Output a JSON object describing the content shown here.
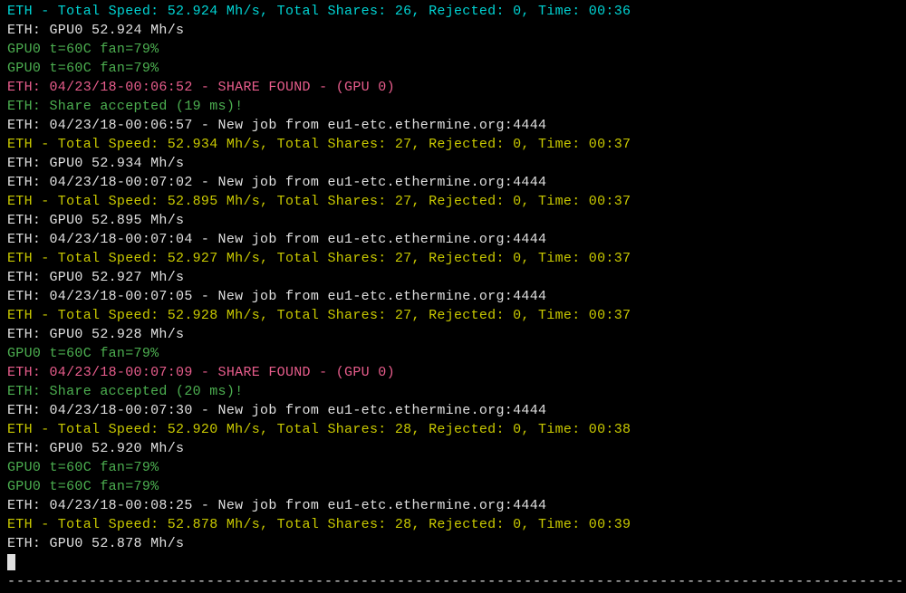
{
  "lines": [
    {
      "color": "teal",
      "text": "ETH - Total Speed: 52.924 Mh/s, Total Shares: 26, Rejected: 0, Time: 00:36"
    },
    {
      "color": "white",
      "text": "ETH: GPU0 52.924 Mh/s"
    },
    {
      "color": "green",
      "text": "GPU0 t=60C fan=79%"
    },
    {
      "color": "green",
      "text": "GPU0 t=60C fan=79%"
    },
    {
      "color": "pink",
      "text": "ETH: 04/23/18-00:06:52 - SHARE FOUND - (GPU 0)"
    },
    {
      "color": "green",
      "text": "ETH: Share accepted (19 ms)!"
    },
    {
      "color": "white",
      "text": "ETH: 04/23/18-00:06:57 - New job from eu1-etc.ethermine.org:4444"
    },
    {
      "color": "yellow",
      "text": "ETH - Total Speed: 52.934 Mh/s, Total Shares: 27, Rejected: 0, Time: 00:37"
    },
    {
      "color": "white",
      "text": "ETH: GPU0 52.934 Mh/s"
    },
    {
      "color": "white",
      "text": "ETH: 04/23/18-00:07:02 - New job from eu1-etc.ethermine.org:4444"
    },
    {
      "color": "yellow",
      "text": "ETH - Total Speed: 52.895 Mh/s, Total Shares: 27, Rejected: 0, Time: 00:37"
    },
    {
      "color": "white",
      "text": "ETH: GPU0 52.895 Mh/s"
    },
    {
      "color": "white",
      "text": "ETH: 04/23/18-00:07:04 - New job from eu1-etc.ethermine.org:4444"
    },
    {
      "color": "yellow",
      "text": "ETH - Total Speed: 52.927 Mh/s, Total Shares: 27, Rejected: 0, Time: 00:37"
    },
    {
      "color": "white",
      "text": "ETH: GPU0 52.927 Mh/s"
    },
    {
      "color": "white",
      "text": "ETH: 04/23/18-00:07:05 - New job from eu1-etc.ethermine.org:4444"
    },
    {
      "color": "yellow",
      "text": "ETH - Total Speed: 52.928 Mh/s, Total Shares: 27, Rejected: 0, Time: 00:37"
    },
    {
      "color": "white",
      "text": "ETH: GPU0 52.928 Mh/s"
    },
    {
      "color": "green",
      "text": "GPU0 t=60C fan=79%"
    },
    {
      "color": "pink",
      "text": "ETH: 04/23/18-00:07:09 - SHARE FOUND - (GPU 0)"
    },
    {
      "color": "green",
      "text": "ETH: Share accepted (20 ms)!"
    },
    {
      "color": "white",
      "text": "ETH: 04/23/18-00:07:30 - New job from eu1-etc.ethermine.org:4444"
    },
    {
      "color": "yellow",
      "text": "ETH - Total Speed: 52.920 Mh/s, Total Shares: 28, Rejected: 0, Time: 00:38"
    },
    {
      "color": "white",
      "text": "ETH: GPU0 52.920 Mh/s"
    },
    {
      "color": "green",
      "text": "GPU0 t=60C fan=79%"
    },
    {
      "color": "green",
      "text": "GPU0 t=60C fan=79%"
    },
    {
      "color": "white",
      "text": "ETH: 04/23/18-00:08:25 - New job from eu1-etc.ethermine.org:4444"
    },
    {
      "color": "yellow",
      "text": "ETH - Total Speed: 52.878 Mh/s, Total Shares: 28, Rejected: 0, Time: 00:39"
    },
    {
      "color": "white",
      "text": "ETH: GPU0 52.878 Mh/s"
    }
  ],
  "divider": "---------------------------------------------------------------------------------------------------------"
}
